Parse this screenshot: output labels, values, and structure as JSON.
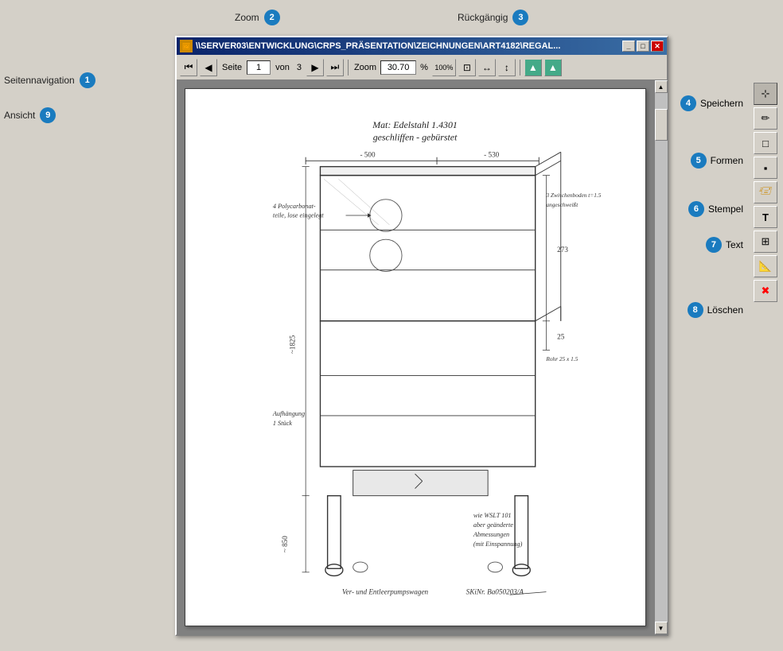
{
  "app": {
    "title": "\\\\SERVER03\\ENTWICKLUNG\\CRPS_PRÄSENTATION\\ZEICHNUNGEN\\ART4182\\REGAL...",
    "icon": "📄"
  },
  "labels": {
    "zoom_top": "Zoom",
    "rueckgaengig": "Rückgängig",
    "seitennavigation": "Seitennavigation",
    "ansicht": "Ansicht",
    "speichern": "Speichern",
    "formen": "Formen",
    "stempel": "Stempel",
    "text": "Text",
    "loeschen": "Löschen"
  },
  "badges": {
    "zoom_num": "2",
    "rueckgaengig_num": "3",
    "seitennavigation_num": "1",
    "ansicht_num": "9",
    "speichern_num": "4",
    "formen_num": "5",
    "stempel_num": "6",
    "text_num": "7",
    "loeschen_num": "8"
  },
  "toolbar": {
    "page_label": "Seite",
    "page_num": "1",
    "von_label": "von",
    "total_pages": "3",
    "zoom_label": "Zoom",
    "zoom_value": "30.70",
    "zoom_percent": "%",
    "zoom_100": "100%"
  },
  "window_buttons": {
    "minimize": "_",
    "maximize": "□",
    "close": "✕"
  }
}
